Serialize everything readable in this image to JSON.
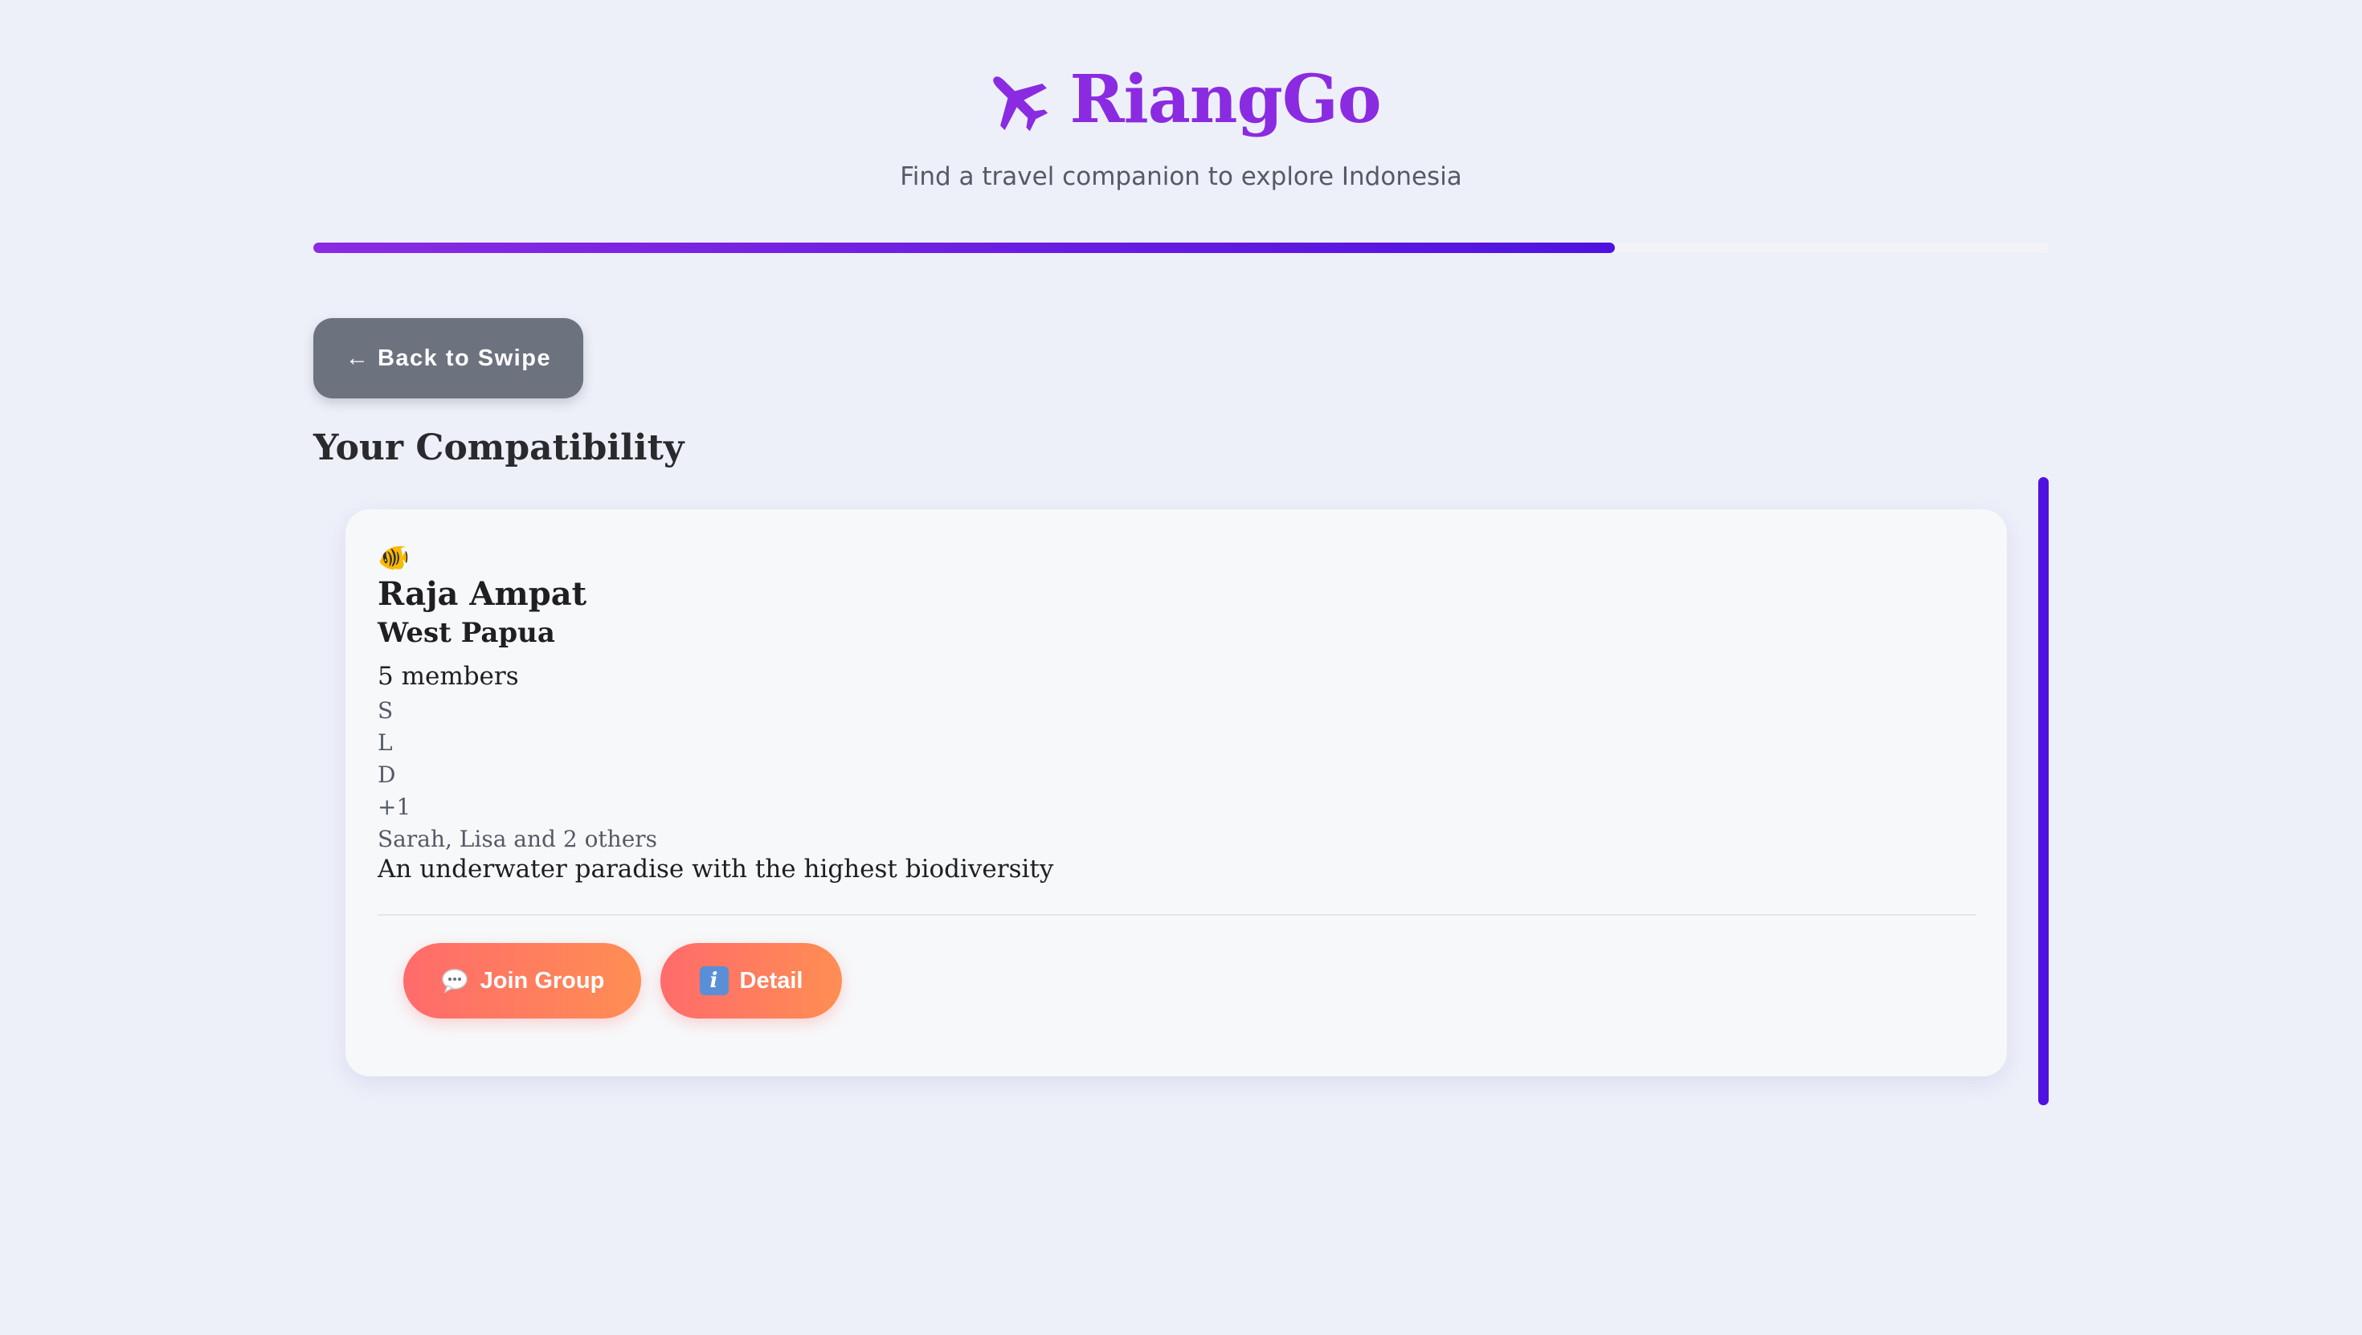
{
  "app": {
    "title": "RiangGo",
    "tagline": "Find a travel companion to explore Indonesia",
    "brand_color": "#8a2be2",
    "logo_icon": "airplane-icon"
  },
  "progress": {
    "value_percent": 75
  },
  "navigation": {
    "back_label": "← Back to Swipe"
  },
  "section": {
    "title": "Your Compatibility"
  },
  "group_card": {
    "emoji": "🐠",
    "place_name": "Raja Ampat",
    "region": "West Papua",
    "member_count": "5 members",
    "avatars": [
      "S",
      "L",
      "D",
      "+1"
    ],
    "member_names": "Sarah, Lisa and 2 others",
    "description": "An underwater paradise with the highest biodiversity",
    "join_label": "Join Group",
    "join_icon": "speech-bubble-icon",
    "detail_label": "Detail",
    "detail_icon": "info-icon",
    "button_gradient": [
      "#ff6b6b",
      "#ff8e53"
    ]
  },
  "colors": {
    "background": "#eef0f9",
    "progress_end": "#4f12e0",
    "back_button": "#6c727e"
  }
}
